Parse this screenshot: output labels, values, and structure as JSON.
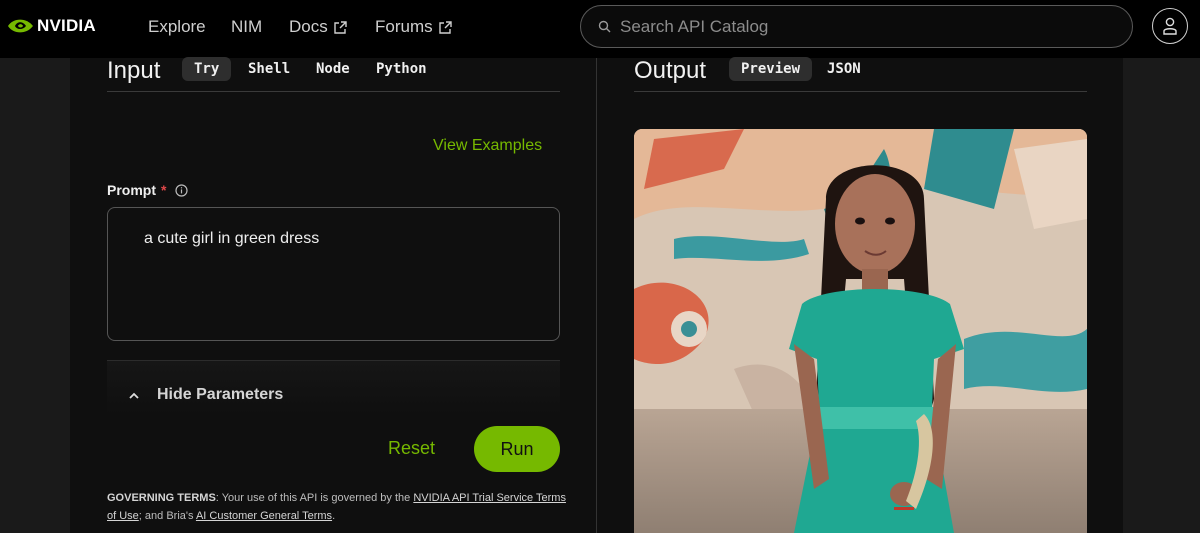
{
  "brand": {
    "name": "NVIDIA",
    "accent": "#76b900"
  },
  "nav": {
    "links": [
      {
        "label": "Explore",
        "external": false
      },
      {
        "label": "NIM",
        "external": false
      },
      {
        "label": "Docs",
        "external": true
      },
      {
        "label": "Forums",
        "external": true
      }
    ],
    "search_placeholder": "Search API Catalog"
  },
  "input": {
    "title": "Input",
    "tabs": [
      "Try",
      "Shell",
      "Node",
      "Python"
    ],
    "active_tab": "Try",
    "view_examples": "View Examples",
    "prompt_label": "Prompt",
    "required_mark": "*",
    "prompt_value": "a cute girl in green dress",
    "hide_parameters": "Hide Parameters",
    "reset_label": "Reset",
    "run_label": "Run"
  },
  "terms": {
    "heading": "GOVERNING TERMS",
    "text1": ": Your use of this API is governed by the ",
    "link1": "NVIDIA API Trial Service Terms of Use",
    "text2": "; and Bria's ",
    "link2": "AI Customer General Terms",
    "text3": "."
  },
  "output": {
    "title": "Output",
    "tabs": [
      "Preview",
      "JSON"
    ],
    "active_tab": "Preview",
    "image_alt": "generated image of a girl in a green dress"
  }
}
